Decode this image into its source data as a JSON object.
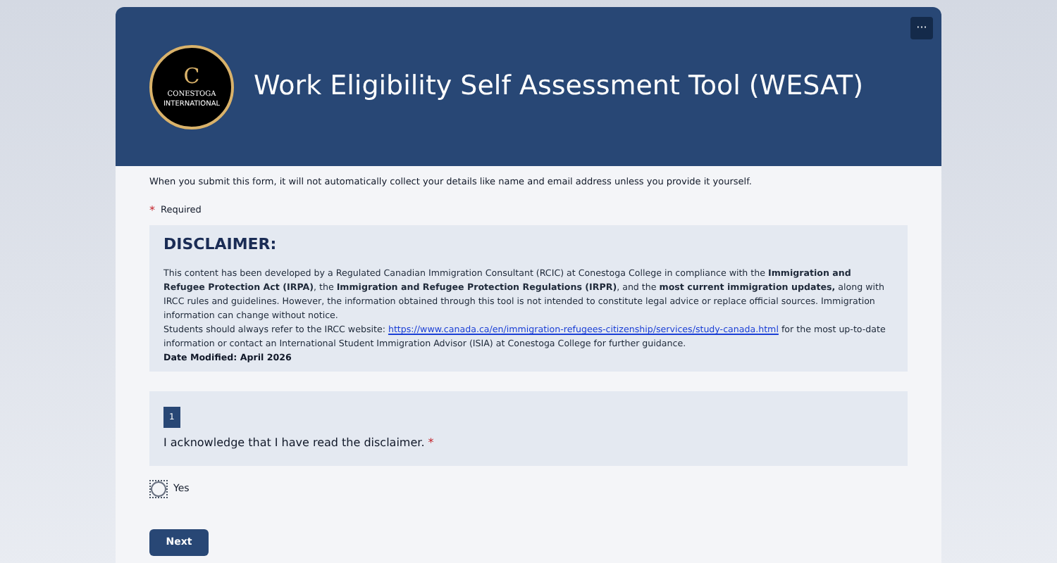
{
  "header": {
    "logo": {
      "letter": "C",
      "name": "CONESTOGA",
      "subtitle": "INTERNATIONAL"
    },
    "title": "Work Eligibility Self Assessment Tool (WESAT)",
    "menu_button": "···"
  },
  "notice": "When you submit this form, it will not automatically collect your details like name and email address unless you provide it yourself.",
  "required_note": {
    "mark": "*",
    "label": "Required"
  },
  "disclaimer": {
    "heading": "DISCLAIMER:",
    "paragraph": "This content has been developed by a Regulated Canadian Immigration Consultant (RCIC) at Conestoga College in compliance with the **Immigration and Refugee Protection Act (IRPA)**, the **Immigration and Refugee Protection Regulations (IRPR)**, and the **most current immigration updates,** along with IRCC rules and guidelines. However, the information obtained through this tool is not intended to constitute legal advice or replace official sources. Immigration information can change without notice.",
    "link_before": "Students should always refer to the IRCC website: ",
    "link": "https://www.canada.ca/en/immigration-refugees-citizenship/services/study-canada.html",
    "link_after": " for the most up-to-date information or contact an International Student Immigration Advisor (ISIA) at Conestoga College for further guidance.",
    "date_modified": "Date Modified: April 2026"
  },
  "question": {
    "number": "1",
    "text": "I acknowledge that I have read the disclaimer.",
    "required_mark": "*",
    "options": [
      {
        "label": "Yes",
        "selected": false
      }
    ]
  },
  "next_button": "Next"
}
